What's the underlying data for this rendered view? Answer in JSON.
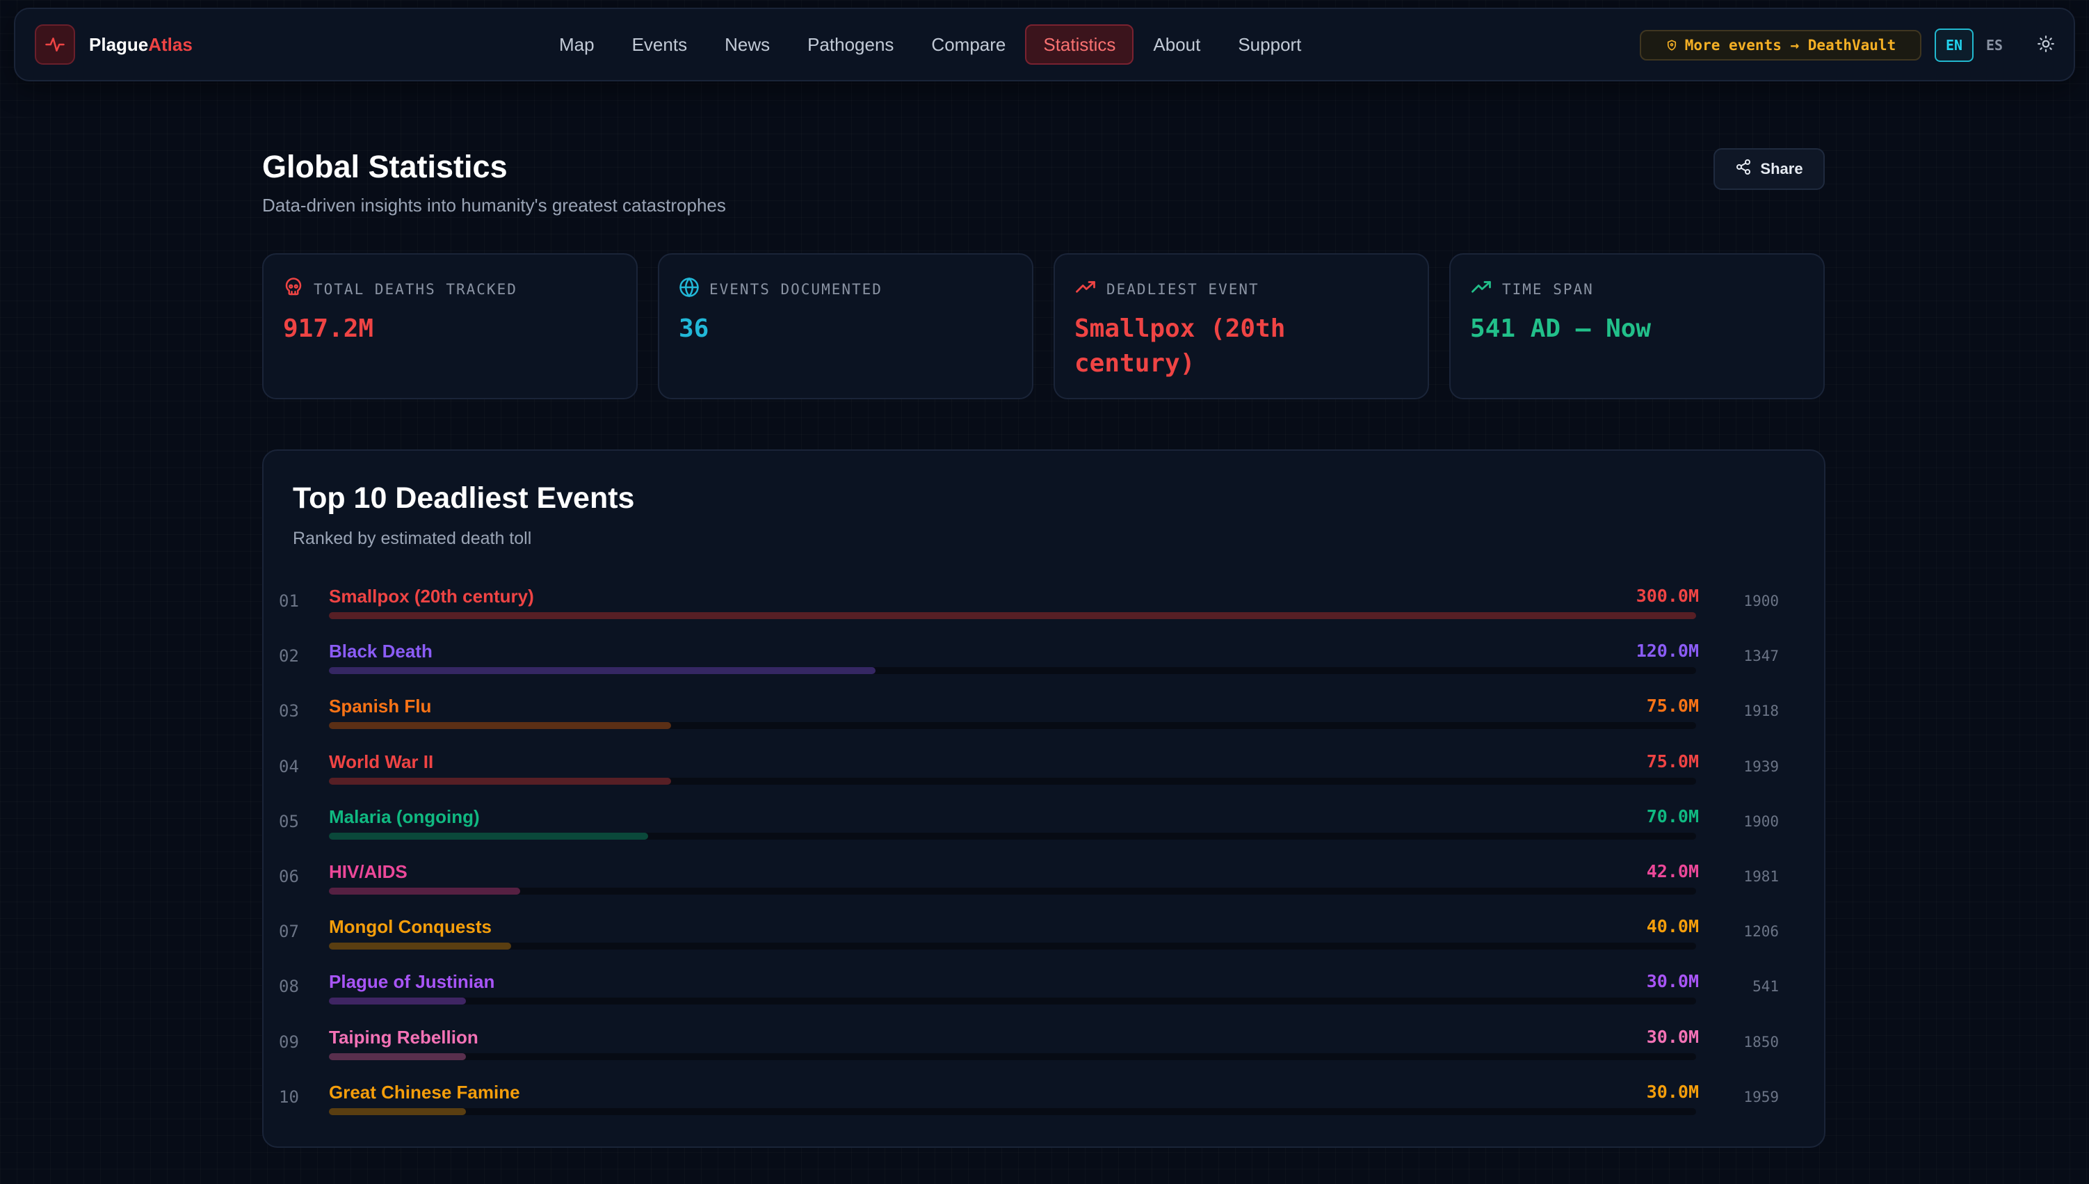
{
  "brand": {
    "name_a": "Plague",
    "name_b": "Atlas",
    "logo_icon": "activity-pulse-icon"
  },
  "nav": {
    "items": [
      {
        "label": "Map"
      },
      {
        "label": "Events"
      },
      {
        "label": "News"
      },
      {
        "label": "Pathogens"
      },
      {
        "label": "Compare"
      },
      {
        "label": "Statistics",
        "active": true
      },
      {
        "label": "About"
      },
      {
        "label": "Support"
      }
    ],
    "promo_label": "More events → DeathVault",
    "lang_en": "EN",
    "lang_es": "ES",
    "theme_icon": "sun-icon"
  },
  "header": {
    "title": "Global Statistics",
    "subtitle": "Data-driven insights into humanity's greatest catastrophes",
    "share_label": "Share"
  },
  "stats": [
    {
      "label": "TOTAL DEATHS TRACKED",
      "value": "917.2M",
      "icon": "skull-icon",
      "color": "#ef4444"
    },
    {
      "label": "EVENTS DOCUMENTED",
      "value": "36",
      "icon": "globe-icon",
      "color": "#22b8d8"
    },
    {
      "label": "DEADLIEST EVENT",
      "value": "Smallpox (20th century)",
      "icon": "trending-up-icon",
      "color": "#ef4444"
    },
    {
      "label": "TIME SPAN",
      "value": "541 AD — Now",
      "icon": "trending-up-icon",
      "color": "#22c08a"
    }
  ],
  "top10": {
    "title": "Top 10 Deadliest Events",
    "subtitle": "Ranked by estimated death toll",
    "items": [
      {
        "rank": "01",
        "name": "Smallpox (20th century)",
        "value": "300.0M",
        "deaths_m": 300,
        "year": "1900",
        "color": "#ef4444"
      },
      {
        "rank": "02",
        "name": "Black Death",
        "value": "120.0M",
        "deaths_m": 120,
        "year": "1347",
        "color": "#8b5cf6"
      },
      {
        "rank": "03",
        "name": "Spanish Flu",
        "value": "75.0M",
        "deaths_m": 75,
        "year": "1918",
        "color": "#f97316"
      },
      {
        "rank": "04",
        "name": "World War II",
        "value": "75.0M",
        "deaths_m": 75,
        "year": "1939",
        "color": "#ef4444"
      },
      {
        "rank": "05",
        "name": "Malaria (ongoing)",
        "value": "70.0M",
        "deaths_m": 70,
        "year": "1900",
        "color": "#10b981"
      },
      {
        "rank": "06",
        "name": "HIV/AIDS",
        "value": "42.0M",
        "deaths_m": 42,
        "year": "1981",
        "color": "#ec4899"
      },
      {
        "rank": "07",
        "name": "Mongol Conquests",
        "value": "40.0M",
        "deaths_m": 40,
        "year": "1206",
        "color": "#f59e0b"
      },
      {
        "rank": "08",
        "name": "Plague of Justinian",
        "value": "30.0M",
        "deaths_m": 30,
        "year": "541",
        "color": "#a855f7"
      },
      {
        "rank": "09",
        "name": "Taiping Rebellion",
        "value": "30.0M",
        "deaths_m": 30,
        "year": "1850",
        "color": "#f472b6"
      },
      {
        "rank": "10",
        "name": "Great Chinese Famine",
        "value": "30.0M",
        "deaths_m": 30,
        "year": "1959",
        "color": "#f59e0b"
      }
    ]
  }
}
